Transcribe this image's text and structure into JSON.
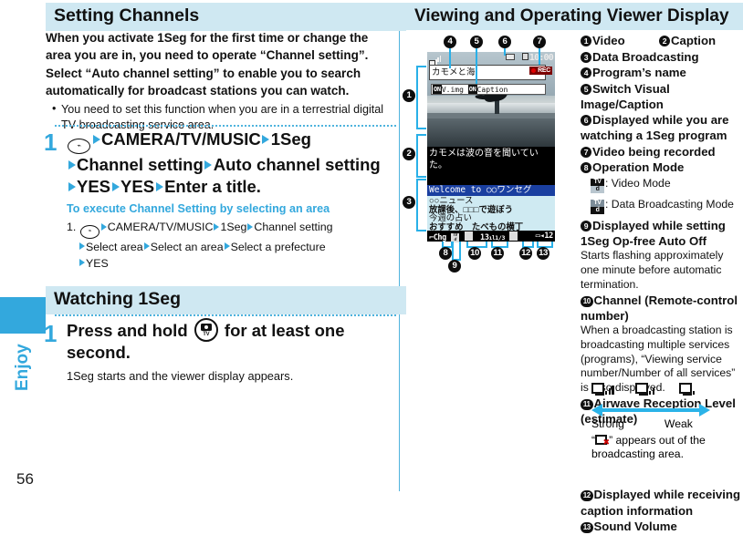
{
  "page": {
    "number": "56",
    "side_tab_label": "Enjoy"
  },
  "left": {
    "section1_title": "Setting Channels",
    "intro": "When you activate 1Seg for the first time or change the area you are in, you need to operate “Channel setting”. Select “Auto channel setting” to enable you to search automatically for broadcast stations you can watch.",
    "bullet1": "You need to set this function when you are in a terrestrial digital TV broadcasting service area.",
    "step1_number": "1",
    "step1_parts": {
      "p1": "CAMERA/TV/MUSIC",
      "p2": "1Seg",
      "p3": "Channel setting",
      "p4": "Auto channel setting",
      "p5": "YES",
      "p6": "YES",
      "p7": "Enter a title."
    },
    "substep_title": "To execute Channel Setting by selecting an area",
    "substep_index": "1.",
    "substep_parts": {
      "p1": "CAMERA/TV/MUSIC",
      "p2": "1Seg",
      "p3": "Channel setting",
      "p4": "Select area",
      "p5": "Select an area",
      "p6": "Select a prefecture",
      "p7": "YES"
    },
    "section2_title": "Watching 1Seg",
    "step2_number": "1",
    "step2_text_a": "Press and hold",
    "step2_text_b": "for at least one second.",
    "step2_note": "1Seg starts and the viewer display appears.",
    "menu_key_label": "MENU",
    "camera_key_label": "TV"
  },
  "right": {
    "section_title": "Viewing and Operating Viewer Display",
    "legend": [
      {
        "n": "1",
        "label": "Video"
      },
      {
        "n": "2",
        "label": "Caption"
      },
      {
        "n": "3",
        "label": "Data Broadcasting"
      },
      {
        "n": "4",
        "label": "Program’s name"
      },
      {
        "n": "5",
        "label": "Switch Visual Image/Caption"
      },
      {
        "n": "6",
        "label": "Displayed while you are watching a 1Seg program"
      },
      {
        "n": "7",
        "label": "Video being recorded"
      },
      {
        "n": "8",
        "label": "Operation Mode"
      },
      {
        "n": "9",
        "label": "Displayed while setting 1Seg Op-free Auto Off"
      },
      {
        "n": "10",
        "label": "Channel (Remote-control number)"
      },
      {
        "n": "11",
        "label": "Airwave Reception Level (estimate)"
      },
      {
        "n": "12",
        "label": "Displayed while receiving caption information"
      },
      {
        "n": "13",
        "label": "Sound Volume"
      }
    ],
    "mode_video_label": ": Video Mode",
    "mode_data_label": ": Data Broadcasting Mode",
    "mode_icon_top": "TV",
    "mode_icon_bottom": "d",
    "note9": "Starts flashing approximately one minute before automatic termination.",
    "note10": "When a broadcasting station is broadcasting multiple services (programs), “Viewing service number/Number of all services” is also displayed.",
    "strong_label": "Strong",
    "weak_label": "Weak",
    "note11a": "“",
    "note11b": "” appears out of the broadcasting area."
  },
  "phone_mock": {
    "status_clock": "10:00",
    "program_title": "カモメと海",
    "rec_badge": "REC",
    "switch_badge_on": "ON",
    "switch_vimg": "V.img",
    "switch_caption": "Caption",
    "caption_line1": "カモメは波の音を聞いてい",
    "caption_line2": "た。",
    "data_header": "Welcome to ○○ワンセグ",
    "data_line1": "○○ニュース",
    "data_line2": "放課後、□□□で遊ぼう",
    "data_line3": "今週の占い",
    "data_line4": "おすすめ　たべもの横丁",
    "bottom_left": "Chg",
    "bottom_channel": "13",
    "bottom_service": "1/3",
    "bottom_volume": "12",
    "mode_top": "TV",
    "mode_bottom": "d"
  },
  "callouts": [
    "1",
    "2",
    "3",
    "4",
    "5",
    "6",
    "7",
    "8",
    "9",
    "10",
    "11",
    "12",
    "13"
  ],
  "colors": {
    "header_bg": "#cfe8f2",
    "accent": "#33a8dd",
    "arrow": "#33a8dd",
    "callout": "#0d0d0d",
    "lead": "#29b0e8"
  }
}
